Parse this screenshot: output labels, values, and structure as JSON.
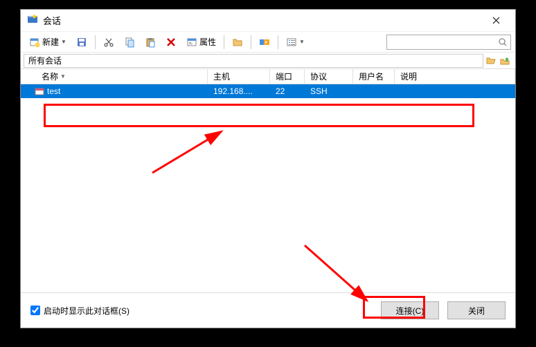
{
  "window": {
    "title": "会话"
  },
  "toolbar": {
    "new_label": "新建",
    "properties_label": "属性"
  },
  "pathbar": {
    "path": "所有会话"
  },
  "columns": {
    "name": "名称",
    "host": "主机",
    "port": "端口",
    "protocol": "协议",
    "username": "用户名",
    "description": "说明"
  },
  "search": {
    "placeholder": ""
  },
  "sessions": [
    {
      "name": "test",
      "host": "192.168....",
      "port": "22",
      "protocol": "SSH",
      "username": "",
      "description": ""
    }
  ],
  "bottom": {
    "show_on_startup": "启动时显示此对话框(S)",
    "connect": "连接(C)",
    "close": "关闭"
  }
}
